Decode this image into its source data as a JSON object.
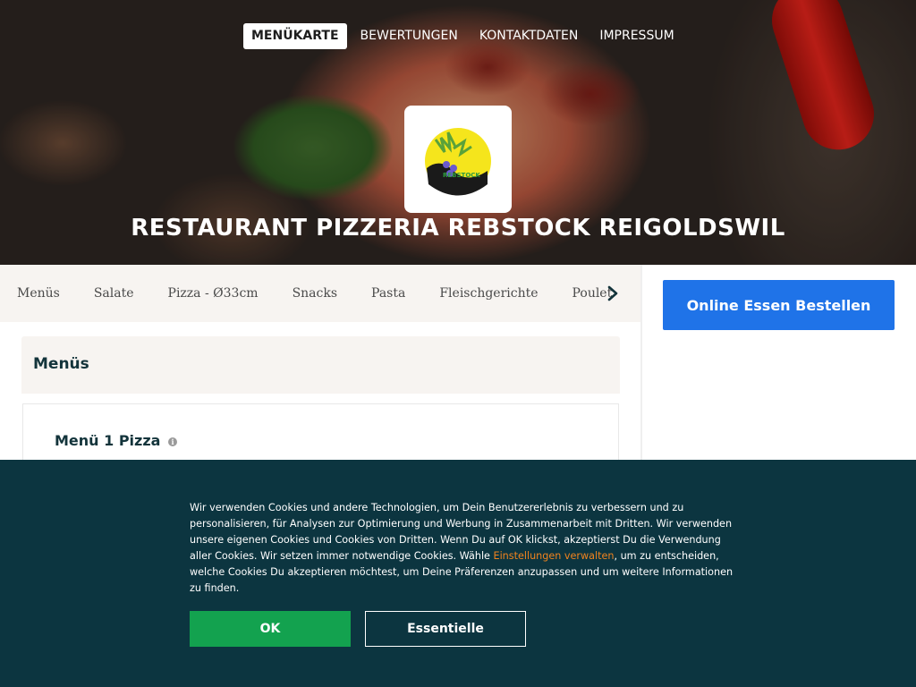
{
  "nav": {
    "items": [
      {
        "label": "MENÜKARTE",
        "active": true
      },
      {
        "label": "BEWERTUNGEN",
        "active": false
      },
      {
        "label": "KONTAKTDATEN",
        "active": false
      },
      {
        "label": "IMPRESSUM",
        "active": false
      }
    ]
  },
  "hero": {
    "title": "RESTAURANT PIZZERIA REBSTOCK REIGOLDSWIL",
    "logo_icon": "restaurant-logo-icon"
  },
  "categories": {
    "items": [
      "Menüs",
      "Salate",
      "Pizza - Ø33cm",
      "Snacks",
      "Pasta",
      "Fleischgerichte",
      "Poulet"
    ],
    "next_icon": "chevron-right-icon"
  },
  "sidebar": {
    "order_button_label": "Online Essen Bestellen"
  },
  "menu": {
    "section_title": "Menüs",
    "first_item": {
      "title": "Menü 1 Pizza",
      "info_icon": "info-icon"
    }
  },
  "cookie": {
    "text_before_link": "Wir verwenden Cookies und andere Technologien, um Dein Benutzererlebnis zu verbessern und zu personalisieren, für Analysen zur Optimierung und Werbung in Zusammenarbeit mit Dritten. Wir verwenden unsere eigenen Cookies und Cookies von Dritten. Wenn Du auf OK klickst, akzeptierst Du die Verwendung aller Cookies. Wir setzen immer notwendige Cookies. Wähle ",
    "link_text": "Einstellungen verwalten",
    "text_after_link": ", um zu entscheiden, welche Cookies Du akzeptieren möchtest, um Deine Präferenzen anzupassen und um weitere Informationen zu finden.",
    "ok_label": "OK",
    "essential_label": "Essentielle"
  },
  "colors": {
    "accent_blue": "#1f73e8",
    "ok_green": "#13a24f",
    "banner_bg": "#0c3540",
    "link_orange": "#f0831e"
  }
}
